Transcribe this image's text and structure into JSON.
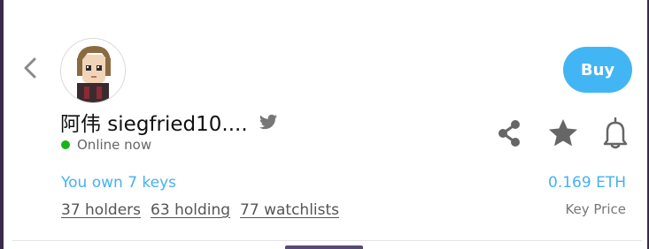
{
  "profile": {
    "name": "阿伟 siegfried10....",
    "status": "Online now",
    "own_keys": "You own 7 keys",
    "stats": {
      "holders": "37 holders",
      "holding": "63 holding",
      "watchlists": "77 watchlists"
    }
  },
  "actions": {
    "buy_label": "Buy"
  },
  "price": {
    "value": "0.169 ETH",
    "label": "Key Price"
  },
  "icons": {
    "back": "chevron-left-icon",
    "social": "twitter-icon",
    "share": "share-icon",
    "favorite": "star-icon",
    "notify": "bell-icon"
  },
  "colors": {
    "accent": "#45b2f0",
    "buy_button": "#42b6f4",
    "online_dot": "#18b418",
    "icon_gray": "#666666"
  }
}
